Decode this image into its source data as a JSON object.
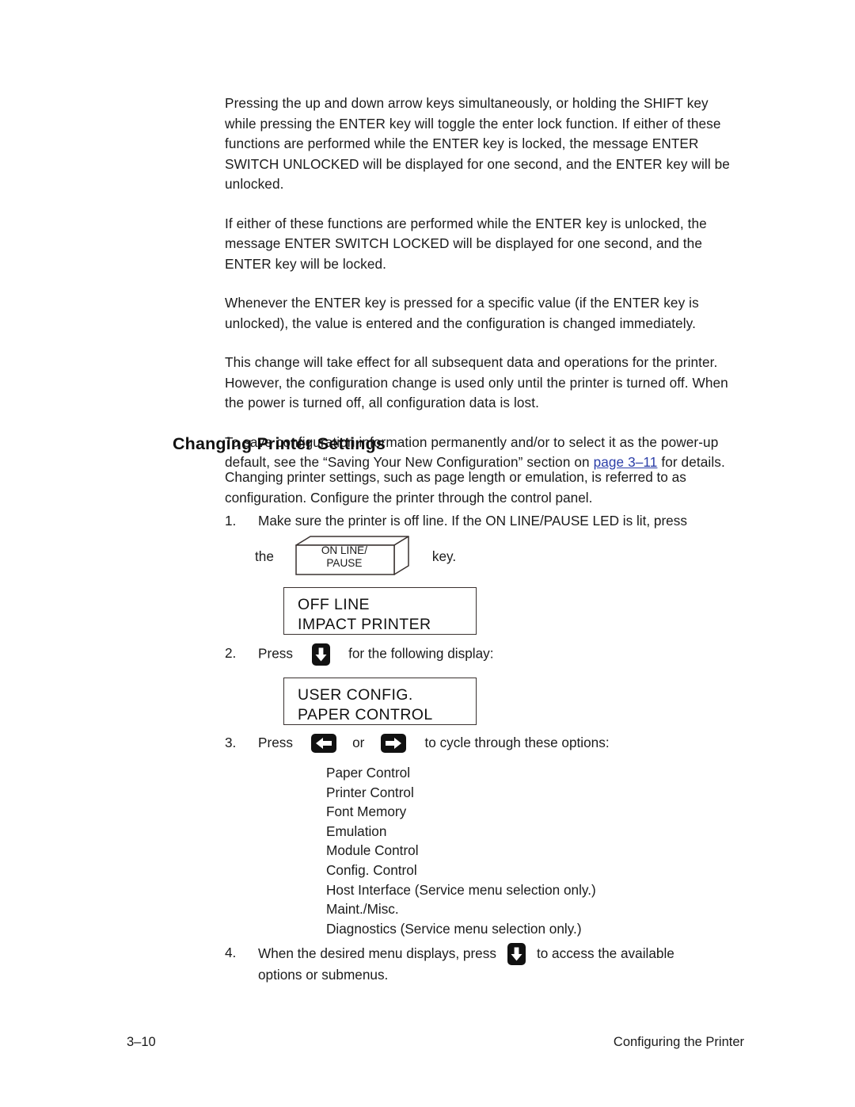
{
  "document": {
    "paragraphs": [
      "Pressing the up and down arrow keys simultaneously, or holding the SHIFT key while pressing the ENTER key will toggle the enter lock function. If either of these functions are performed while the ENTER key is locked, the message ENTER SWITCH UNLOCKED will be displayed for one second, and the ENTER key will be unlocked.",
      "If either of these functions are performed while the ENTER key is unlocked, the message ENTER SWITCH LOCKED will be displayed for one second, and the ENTER key will be locked.",
      "Whenever the ENTER key is pressed for a specific value (if the ENTER key is unlocked), the value is entered and the configuration is changed immediately.",
      "This change will take effect for all subsequent data and operations for the printer. However, the configuration change is used only until the printer is turned off. When the power is turned off, all configuration data is lost."
    ],
    "save_paragraph": {
      "before_link": "To save configuration information permanently and/or to select it as the power-up default, see the “Saving Your New Configuration” section on ",
      "link_text": "page 3–11",
      "after_link": " for details."
    },
    "heading": "Changing Printer Settings",
    "sub_intro": "Changing printer settings, such as page length or emulation, is referred to as configuration. Configure the printer through the control panel."
  },
  "steps": {
    "step1": {
      "number": "1.",
      "text": "Make sure the printer is off line. If the ON LINE/PAUSE LED is lit, press"
    },
    "keyline": {
      "lead": "the",
      "trail": "key.",
      "keycap_line1": "ON LINE/",
      "keycap_line2": "PAUSE"
    },
    "step2": {
      "number": "2.",
      "before_icon": "Press",
      "after_icon": "for the following display:"
    },
    "step3": {
      "number": "3.",
      "before_icon": "Press",
      "between_icons": "or",
      "after_icon": "to cycle through these options:"
    },
    "step4": {
      "number": "4.",
      "before_icon": "When the desired menu displays, press",
      "after_icon": "to access the available",
      "second_line": "options or submenus."
    }
  },
  "displays": {
    "display1": {
      "line1": "OFF LINE",
      "line2": "IMPACT PRINTER"
    },
    "display2": {
      "line1": "USER CONFIG.",
      "line2": "PAPER CONTROL"
    }
  },
  "options_list": [
    "Paper Control",
    "Printer Control",
    "Font Memory",
    "Emulation",
    "Module Control",
    "Config. Control",
    "Host Interface (Service menu selection only.)",
    "Maint./Misc.",
    "Diagnostics (Service menu selection only.)"
  ],
  "footer": {
    "page_number": "3–10",
    "section_title": "Configuring the Printer"
  },
  "icons": {
    "down_arrow": "arrow-down-key-icon",
    "left_arrow": "arrow-left-key-icon",
    "right_arrow": "arrow-right-key-icon"
  },
  "colors": {
    "text": "#1b1b1b",
    "link": "#2c3fa8",
    "key_fill": "#111111",
    "lcd_border": "#3a3230"
  }
}
